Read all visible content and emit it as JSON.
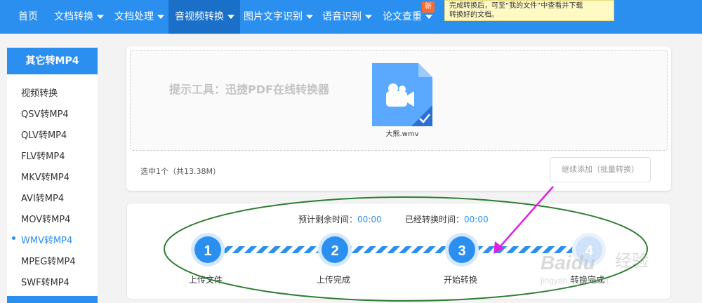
{
  "nav": {
    "items": [
      {
        "label": "首页",
        "has_caret": false
      },
      {
        "label": "文档转换",
        "has_caret": true
      },
      {
        "label": "文档处理",
        "has_caret": true
      },
      {
        "label": "音视频转换",
        "has_caret": true,
        "active": true
      },
      {
        "label": "图片文字识别",
        "has_caret": true
      },
      {
        "label": "语音识别",
        "has_caret": true
      },
      {
        "label": "论文查重",
        "has_caret": true
      }
    ],
    "new_badge": "新",
    "tooltip_lines": [
      "完成转换后，可至“我的文件”中查看并下载",
      "转换好的文档。"
    ]
  },
  "sidebar": {
    "title": "其它转MP4",
    "items": [
      "视频转换",
      "QSV转MP4",
      "QLV转MP4",
      "FLV转MP4",
      "MKV转MP4",
      "AVI转MP4",
      "MOV转MP4",
      "WMV转MP4",
      "MPEG转MP4",
      "SWF转MP4"
    ],
    "active_index": 7
  },
  "upload": {
    "hint": "提示工具：迅捷PDF在线转换器",
    "file_name": "大熊.wmv",
    "file_icon": "video-file-icon",
    "selected_info": "选中1个（共13.38M）",
    "add_button": "继续添加（批量转换）"
  },
  "progress": {
    "remaining_label": "预计剩余时间：",
    "remaining_value": "00:00",
    "elapsed_label": "已经转换时间：",
    "elapsed_value": "00:00",
    "steps": [
      {
        "number": "1",
        "label": "上传文件"
      },
      {
        "number": "2",
        "label": "上传完成"
      },
      {
        "number": "3",
        "label": "开始转换"
      },
      {
        "number": "4",
        "label": "转换完成"
      }
    ]
  },
  "watermark": {
    "logo_text": "Baidu",
    "suffix": "经验",
    "url": "jingyan.baidu.com"
  },
  "colors": {
    "primary": "#2b8ff0",
    "nav_active": "#1a6fc9",
    "annotation_oval": "#2e7d32",
    "annotation_arrow": "#e020e0"
  }
}
